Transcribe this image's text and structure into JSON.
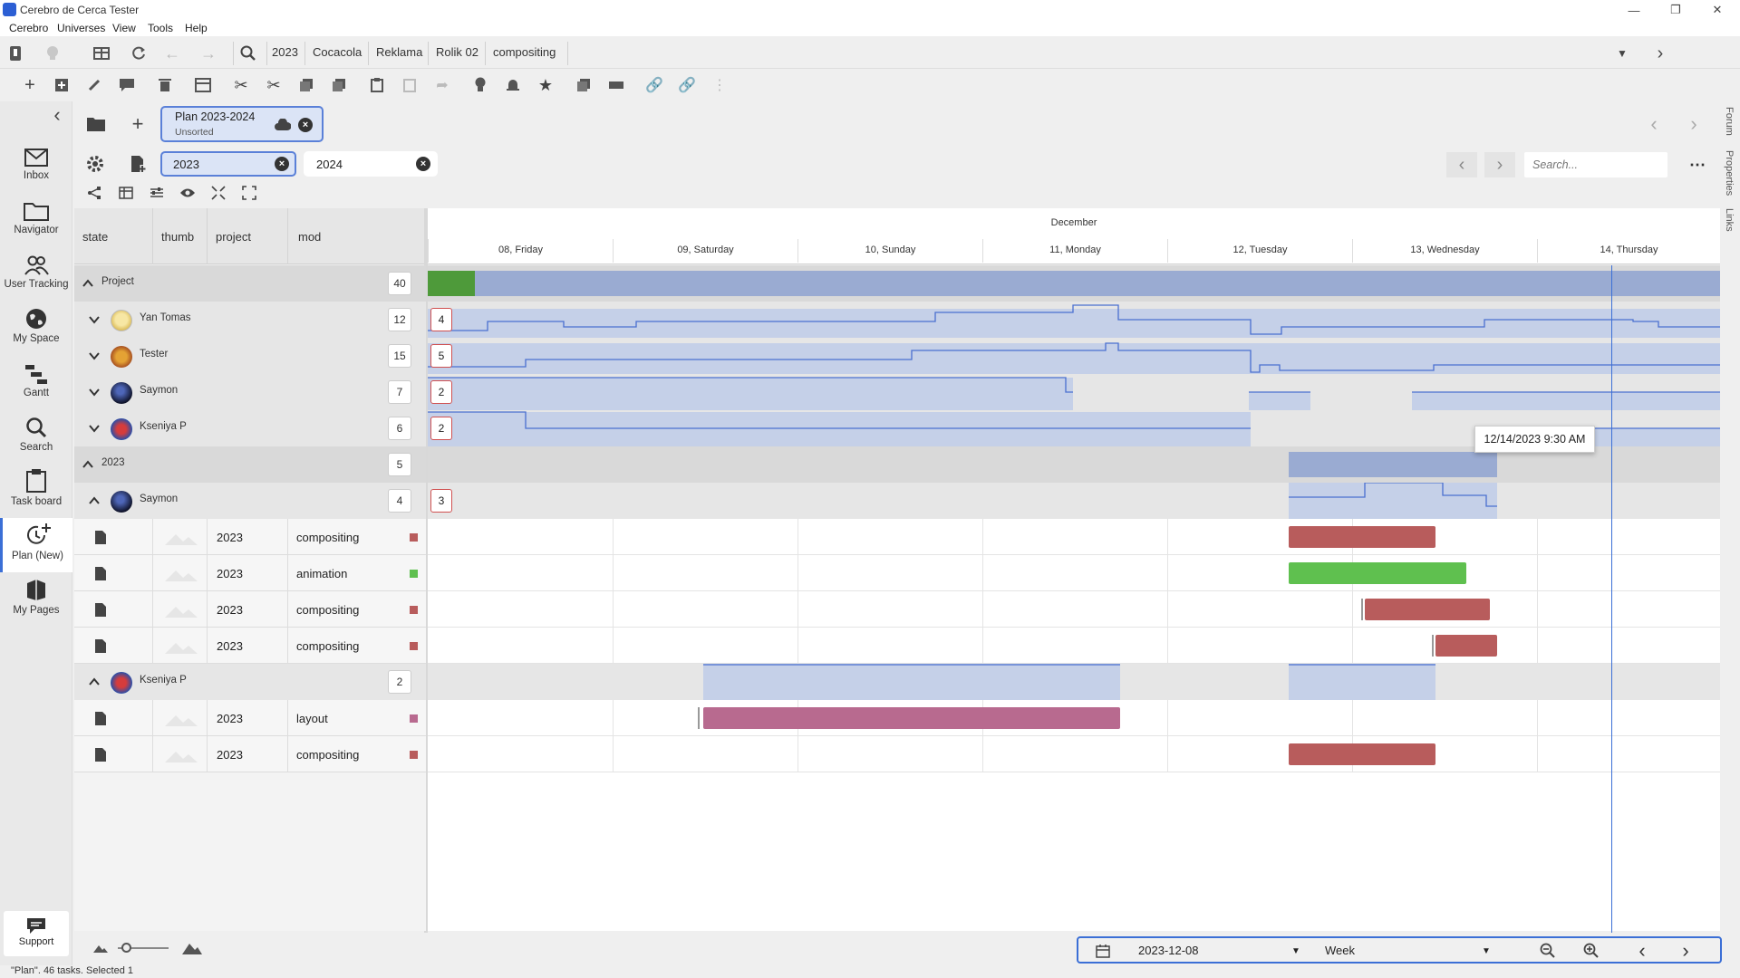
{
  "window": {
    "title": "Cerebro de Cerca  Tester"
  },
  "menu": [
    "Cerebro",
    "Universes",
    "View",
    "Tools",
    "Help"
  ],
  "breadcrumbs": [
    "2023",
    "Cocacola",
    "Reklama",
    "Rolik 02",
    "compositing"
  ],
  "sidebar": {
    "items": [
      {
        "label": "Inbox",
        "icon": "mail-icon"
      },
      {
        "label": "Navigator",
        "icon": "folder-icon"
      },
      {
        "label": "User Tracking",
        "icon": "users-icon"
      },
      {
        "label": "My Space",
        "icon": "globe-icon"
      },
      {
        "label": "Gantt",
        "icon": "gantt-icon"
      },
      {
        "label": "Search",
        "icon": "search-icon"
      },
      {
        "label": "Task board",
        "icon": "clipboard-icon"
      },
      {
        "label": "Plan (New)",
        "icon": "clock-plus-icon"
      },
      {
        "label": "My Pages",
        "icon": "book-icon"
      }
    ],
    "support": "Support"
  },
  "right_panels": [
    "Forum",
    "Properties",
    "Links"
  ],
  "plan_tab": {
    "title": "Plan 2023-2024",
    "subtitle": "Unsorted"
  },
  "filters": [
    "2023",
    "2024"
  ],
  "search": {
    "placeholder": "Search..."
  },
  "columns": [
    "state",
    "thumb",
    "project",
    "mod"
  ],
  "timeline": {
    "month": "December",
    "days": [
      "08, Friday",
      "09, Saturday",
      "10, Sunday",
      "11, Monday",
      "12, Tuesday",
      "13, Wednesday",
      "14, Thursday"
    ]
  },
  "rows": {
    "project_group": {
      "label": "Project",
      "count": "40"
    },
    "users": [
      {
        "name": "Yan Tomas",
        "count": "12",
        "load": "4"
      },
      {
        "name": "Tester",
        "count": "15",
        "load": "5"
      },
      {
        "name": "Saymon",
        "count": "7",
        "load": "2"
      },
      {
        "name": "Kseniya P",
        "count": "6",
        "load": "2"
      }
    ],
    "group_2023": {
      "label": "2023",
      "count": "5"
    },
    "saymon": {
      "name": "Saymon",
      "count": "4",
      "load": "3"
    },
    "saymon_tasks": [
      {
        "project": "2023",
        "mod": "compositing",
        "color": "#b85c5c"
      },
      {
        "project": "2023",
        "mod": "animation",
        "color": "#5fc04f"
      },
      {
        "project": "2023",
        "mod": "compositing",
        "color": "#b85c5c"
      },
      {
        "project": "2023",
        "mod": "compositing",
        "color": "#b85c5c"
      }
    ],
    "kseniya": {
      "name": "Kseniya P",
      "count": "2"
    },
    "kseniya_tasks": [
      {
        "project": "2023",
        "mod": "layout",
        "color": "#b86a8f"
      },
      {
        "project": "2023",
        "mod": "compositing",
        "color": "#b85c5c"
      }
    ]
  },
  "tooltip": "12/14/2023 9:30 AM",
  "bottom": {
    "date": "2023-12-08",
    "range": "Week"
  },
  "status": "\"Plan\". 46 tasks. Selected 1"
}
